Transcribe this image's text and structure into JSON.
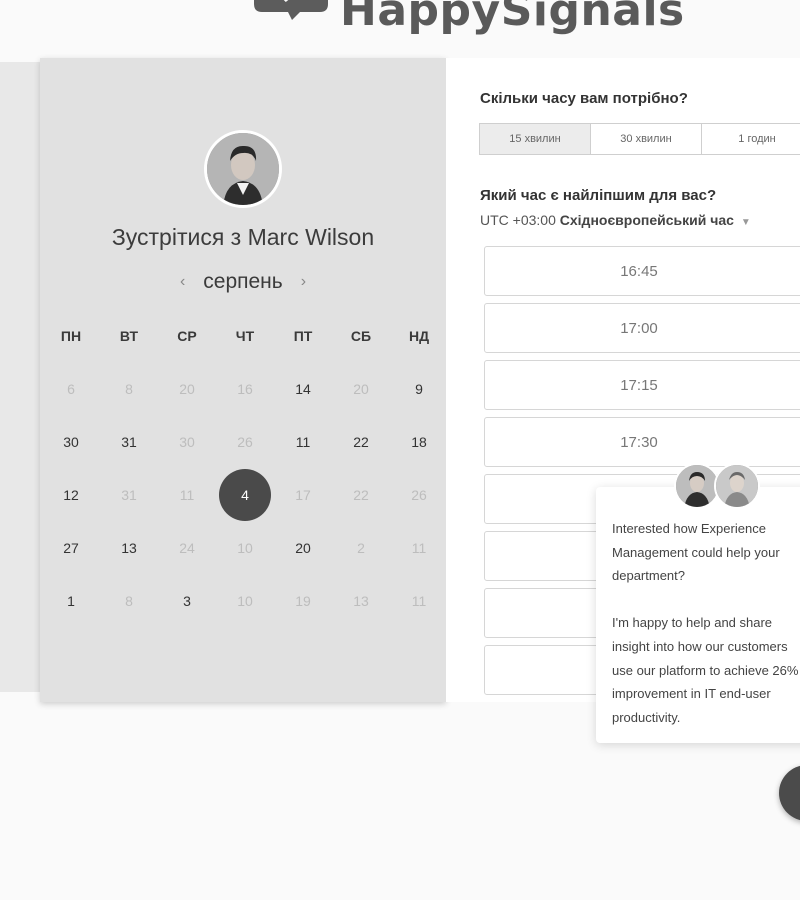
{
  "brand": {
    "name": "HappySignals"
  },
  "calendar": {
    "title": "Зустрітися з Marc Wilson",
    "month": "серпень",
    "weekdays": [
      "ПН",
      "ВТ",
      "СР",
      "ЧТ",
      "ПТ",
      "СБ",
      "НД"
    ],
    "days": [
      {
        "v": "6",
        "dim": true
      },
      {
        "v": "8",
        "dim": true
      },
      {
        "v": "20",
        "dim": true
      },
      {
        "v": "16",
        "dim": true
      },
      {
        "v": "14",
        "dim": false
      },
      {
        "v": "20",
        "dim": true
      },
      {
        "v": "9",
        "dim": false
      },
      {
        "v": "30",
        "dim": false
      },
      {
        "v": "31",
        "dim": false
      },
      {
        "v": "30",
        "dim": true
      },
      {
        "v": "26",
        "dim": true
      },
      {
        "v": "11",
        "dim": false
      },
      {
        "v": "22",
        "dim": false
      },
      {
        "v": "18",
        "dim": false
      },
      {
        "v": "12",
        "dim": false
      },
      {
        "v": "31",
        "dim": true
      },
      {
        "v": "11",
        "dim": true
      },
      {
        "v": "4",
        "dim": false,
        "selected": true
      },
      {
        "v": "17",
        "dim": true
      },
      {
        "v": "22",
        "dim": true
      },
      {
        "v": "26",
        "dim": true
      },
      {
        "v": "27",
        "dim": false
      },
      {
        "v": "13",
        "dim": false
      },
      {
        "v": "24",
        "dim": true
      },
      {
        "v": "10",
        "dim": true
      },
      {
        "v": "20",
        "dim": false
      },
      {
        "v": "2",
        "dim": true
      },
      {
        "v": "11",
        "dim": true
      },
      {
        "v": "1",
        "dim": false
      },
      {
        "v": "8",
        "dim": true
      },
      {
        "v": "3",
        "dim": false
      },
      {
        "v": "10",
        "dim": true
      },
      {
        "v": "19",
        "dim": true
      },
      {
        "v": "13",
        "dim": true
      },
      {
        "v": "11",
        "dim": true
      }
    ]
  },
  "booking": {
    "duration_question": "Скільки часу вам потрібно?",
    "durations": [
      "15 хвилин",
      "30 хвилин",
      "1 годин"
    ],
    "time_question": "Який час є найліпшим для вас?",
    "tz_offset": "UTC +03:00",
    "tz_name": "Східноєвропейський час",
    "slots": [
      "16:45",
      "17:00",
      "17:15",
      "17:30",
      "",
      "",
      "",
      ""
    ]
  },
  "chat": {
    "message": "Interested how Experience Management could help your department?\n\nI'm happy to help and share insight into how our customers use our platform to achieve 26% improvement in IT end-user productivity."
  }
}
